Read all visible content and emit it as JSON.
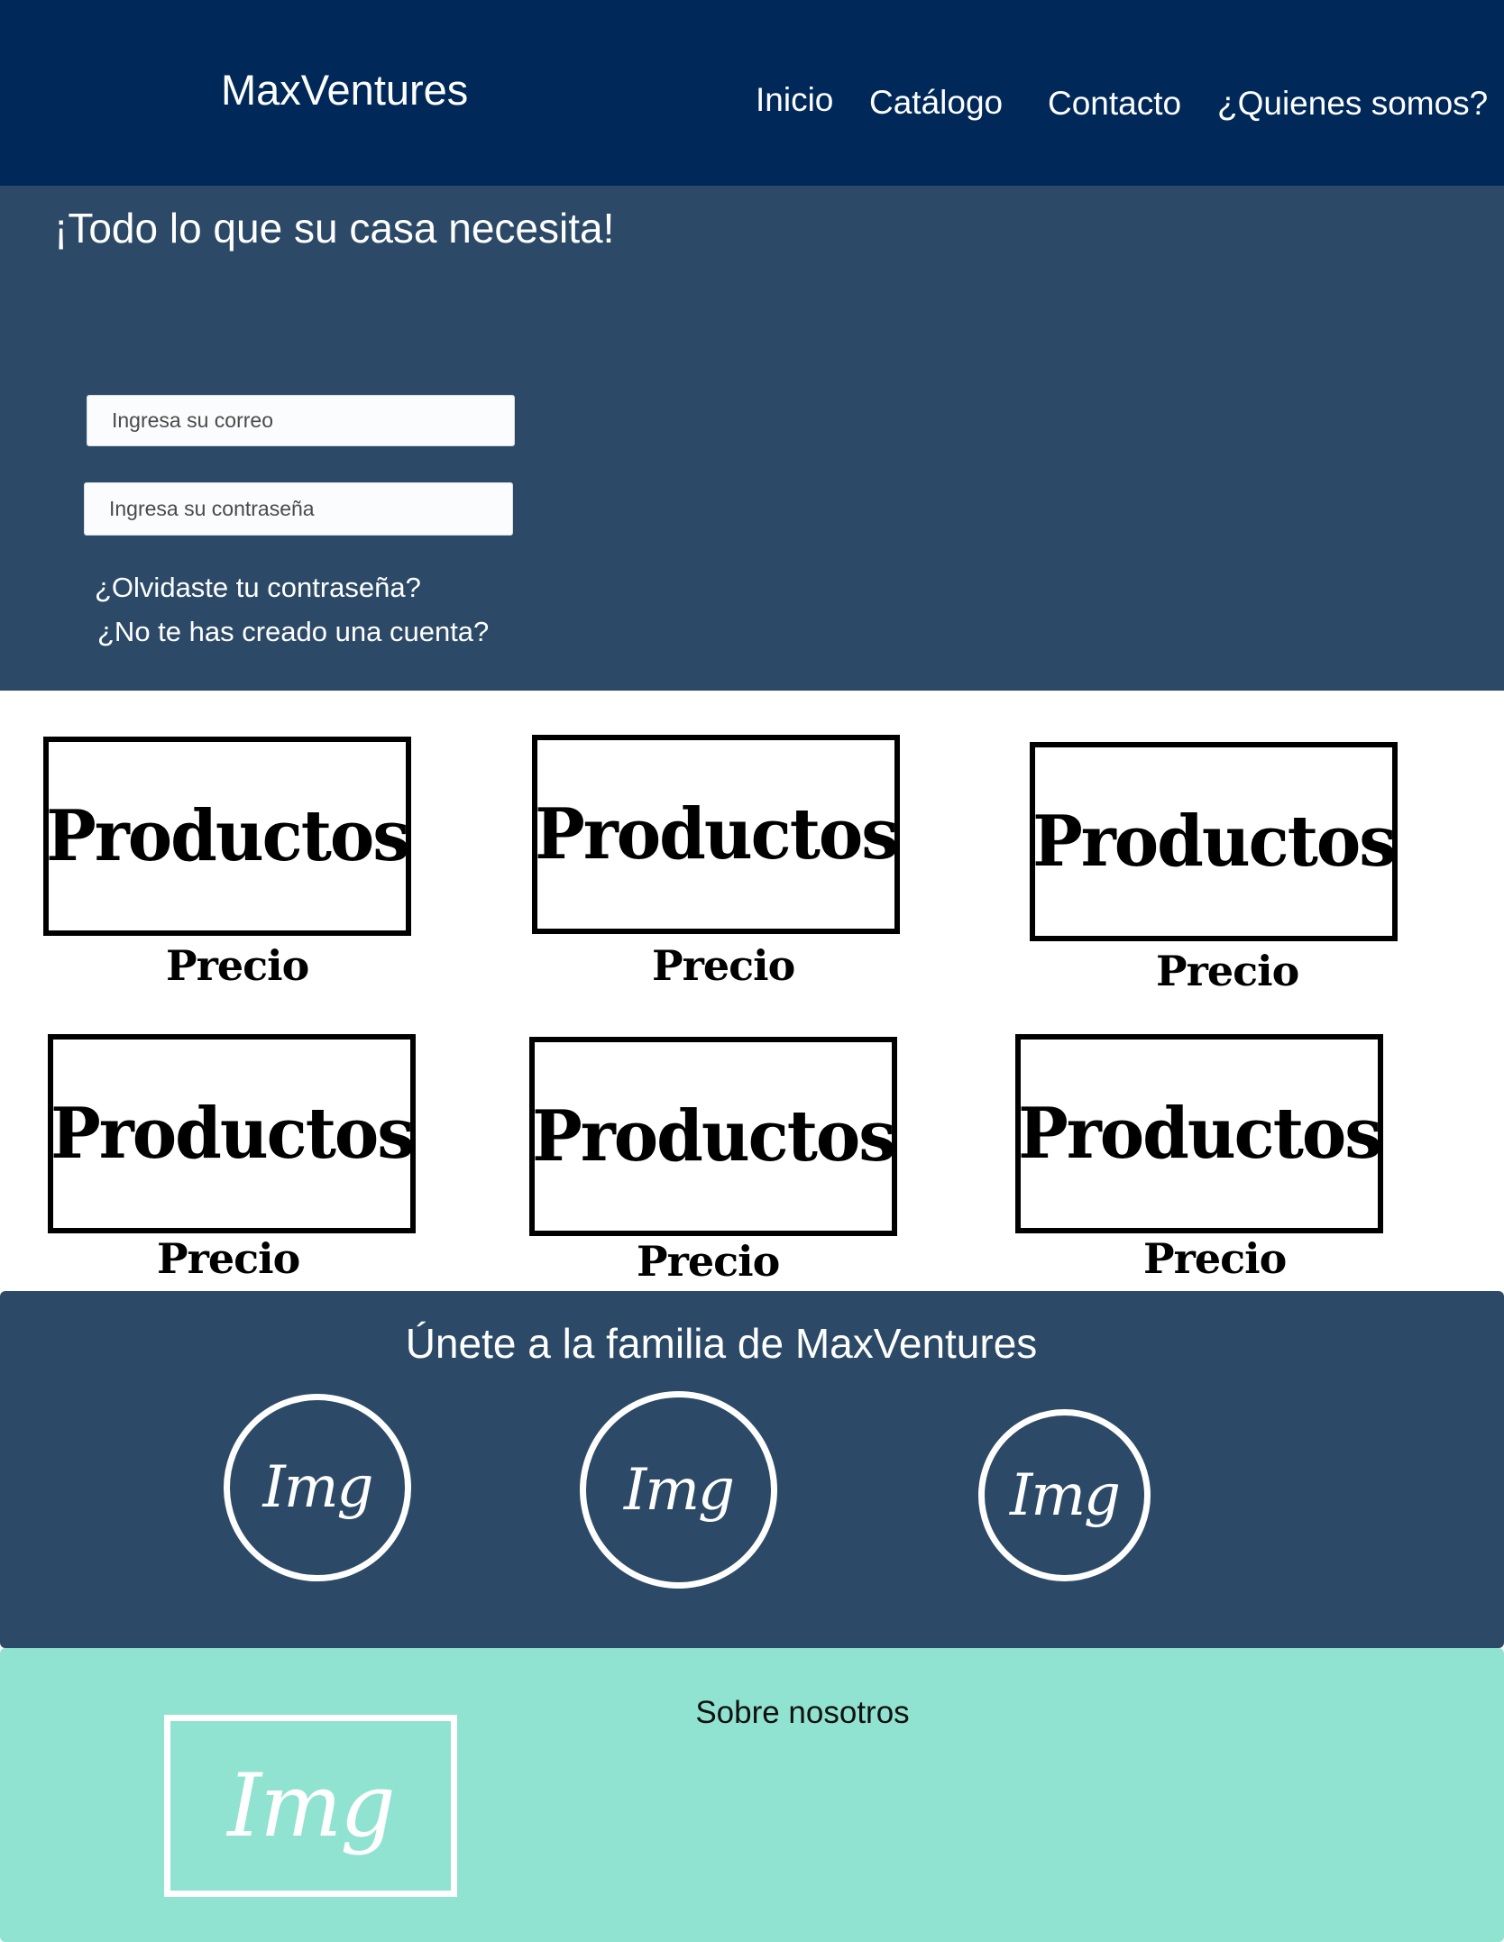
{
  "header": {
    "logo": "MaxVentures",
    "nav": [
      {
        "label": "Inicio"
      },
      {
        "label": "Catálogo"
      },
      {
        "label": "Contacto"
      },
      {
        "label": "¿Quienes somos?"
      }
    ]
  },
  "hero": {
    "title": "¡Todo lo que su casa necesita!",
    "email_placeholder": "Ingresa su correo",
    "password_placeholder": "Ingresa su contraseña",
    "forgot_link": "¿Olvidaste tu contraseña?",
    "signup_link": "¿No te has creado una cuenta?"
  },
  "products": [
    {
      "label": "Productos",
      "price": "Precio"
    },
    {
      "label": "Productos",
      "price": "Precio"
    },
    {
      "label": "Productos",
      "price": "Precio"
    },
    {
      "label": "Productos",
      "price": "Precio"
    },
    {
      "label": "Productos",
      "price": "Precio"
    },
    {
      "label": "Productos",
      "price": "Precio"
    }
  ],
  "join": {
    "title": "Únete a la familia de MaxVentures",
    "images": [
      {
        "label": "Img"
      },
      {
        "label": "Img"
      },
      {
        "label": "Img"
      }
    ]
  },
  "about": {
    "title": "Sobre nosotros",
    "image_label": "Img"
  },
  "colors": {
    "header_bg": "#00295a",
    "section_bg": "#2c4a67",
    "about_bg": "#91e3d1"
  }
}
